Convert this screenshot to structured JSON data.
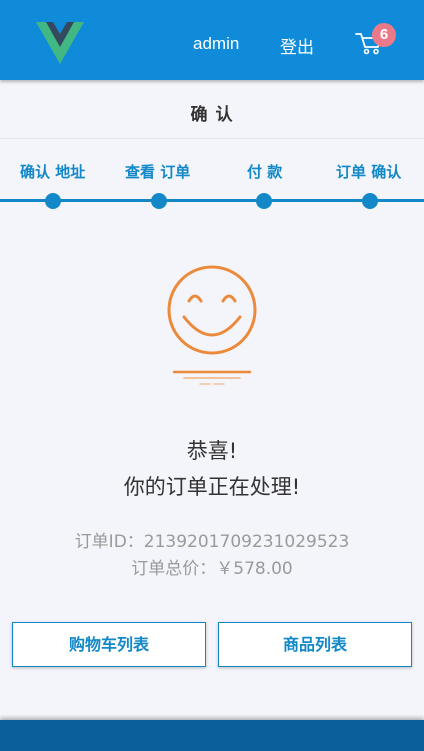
{
  "colors": {
    "brand": "#0f8bd9",
    "accent": "#1288c8",
    "badge": "#ea7a8a",
    "smiley": "#ec8a3c",
    "footer": "#0b5f9b"
  },
  "header": {
    "logo_icon": "vue-logo-icon",
    "user": "admin",
    "logout": "登出",
    "cart_icon": "cart-icon",
    "cart_count": "6"
  },
  "page": {
    "title": "确 认"
  },
  "steps": [
    {
      "label": "确认 地址"
    },
    {
      "label": "查看 订单"
    },
    {
      "label": "付 款"
    },
    {
      "label": "订单 确认"
    }
  ],
  "result": {
    "icon": "smiley-face-icon",
    "line1": "恭喜!",
    "line2": "你的订单正在处理!",
    "order_id": "订单ID：2139201709231029523",
    "order_total": "订单总价：￥578.00"
  },
  "actions": {
    "cart_list": "购物车列表",
    "goods_list": "商品列表"
  }
}
